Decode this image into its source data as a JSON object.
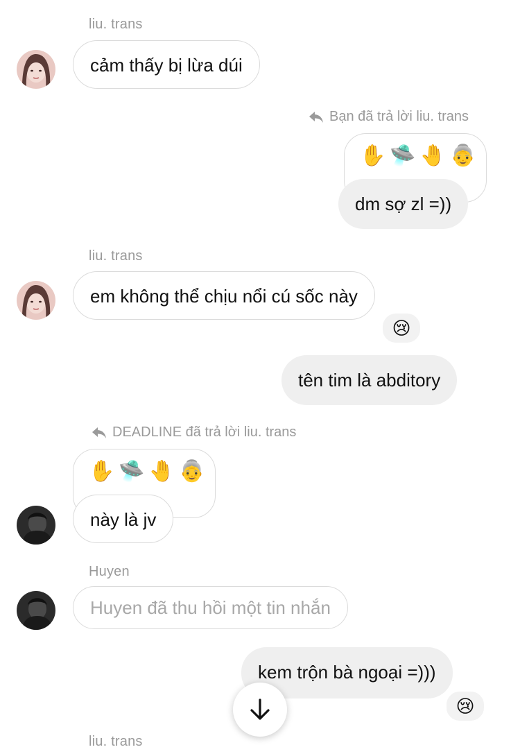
{
  "messages": {
    "m1": {
      "sender": "liu. trans",
      "text": "cảm thấy bị lừa dúi"
    },
    "m2": {
      "reply_note": "Bạn đã trả lời liu. trans",
      "quoted": "✋🛸🤚👵",
      "text": "dm sợ zl =))"
    },
    "m3": {
      "sender": "liu. trans",
      "text": "em không thể chịu nổi cú sốc này",
      "reaction": "😢"
    },
    "m4": {
      "text": "tên tim là abditory"
    },
    "m5": {
      "reply_note": "DEADLINE đã trả lời liu. trans",
      "quoted": "✋🛸🤚👵",
      "text": "này là jv"
    },
    "m6": {
      "sender": "Huyen",
      "text": "Huyen đã thu hồi một tin nhắn"
    },
    "m7": {
      "text": "kem trộn bà ngoại =)))",
      "reaction": "😢"
    },
    "m8": {
      "sender": "liu. trans"
    }
  },
  "icons": {
    "reply": "reply-arrow-icon",
    "scroll_down": "arrow-down-icon"
  },
  "colors": {
    "my_bubble": "#efefef",
    "border": "#dbdbdb",
    "secondary_text": "#9a9a9a"
  }
}
